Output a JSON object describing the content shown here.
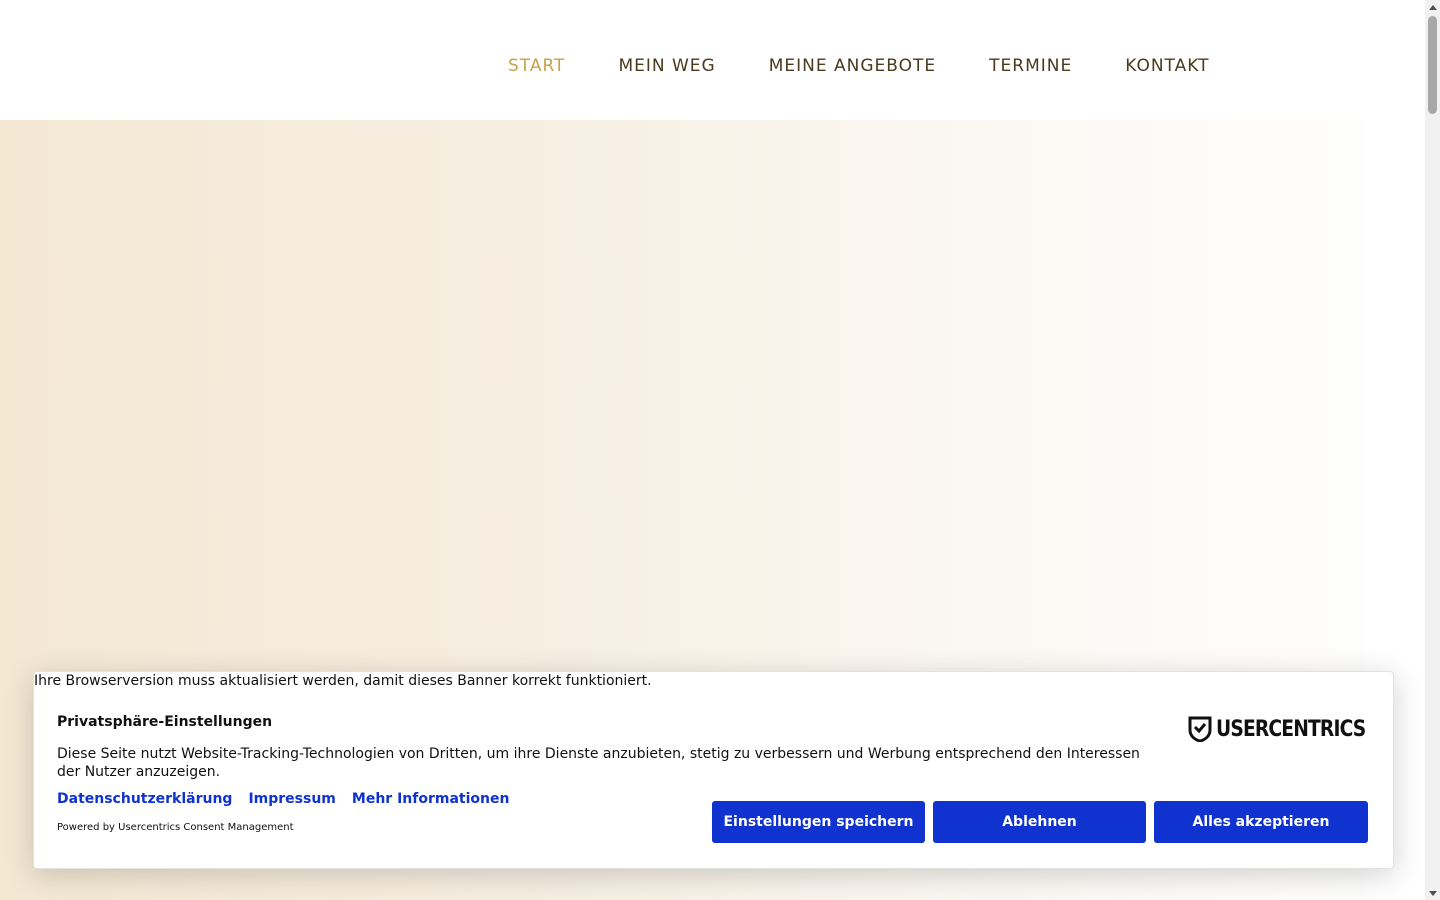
{
  "nav": {
    "items": [
      {
        "label": "START",
        "active": true
      },
      {
        "label": "MEIN WEG",
        "active": false
      },
      {
        "label": "MEINE ANGEBOTE",
        "active": false
      },
      {
        "label": "TERMINE",
        "active": false
      },
      {
        "label": "KONTAKT",
        "active": false
      }
    ]
  },
  "colors": {
    "nav_text": "#4a3a1e",
    "nav_active": "#c6a24a",
    "hero_start": "#f4e8d3",
    "button_blue": "#1032cf"
  },
  "consent": {
    "browser_warning": "Ihre Browserversion muss aktualisiert werden, damit dieses Banner korrekt funktioniert.",
    "title": "Privatsphäre-Einstellungen",
    "description": "Diese Seite nutzt Website-Tracking-Technologien von Dritten, um ihre Dienste anzubieten, stetig zu verbessern und Werbung entsprechend den Interessen der Nutzer anzuzeigen.",
    "links": {
      "privacy": "Datenschutzerklärung",
      "imprint": "Impressum",
      "more_info": "Mehr Informationen"
    },
    "powered_by": "Powered by Usercentrics Consent Management",
    "logo_text": "USERCENTRICS",
    "buttons": {
      "save": "Einstellungen speichern",
      "deny": "Ablehnen",
      "accept": "Alles akzeptieren"
    }
  }
}
